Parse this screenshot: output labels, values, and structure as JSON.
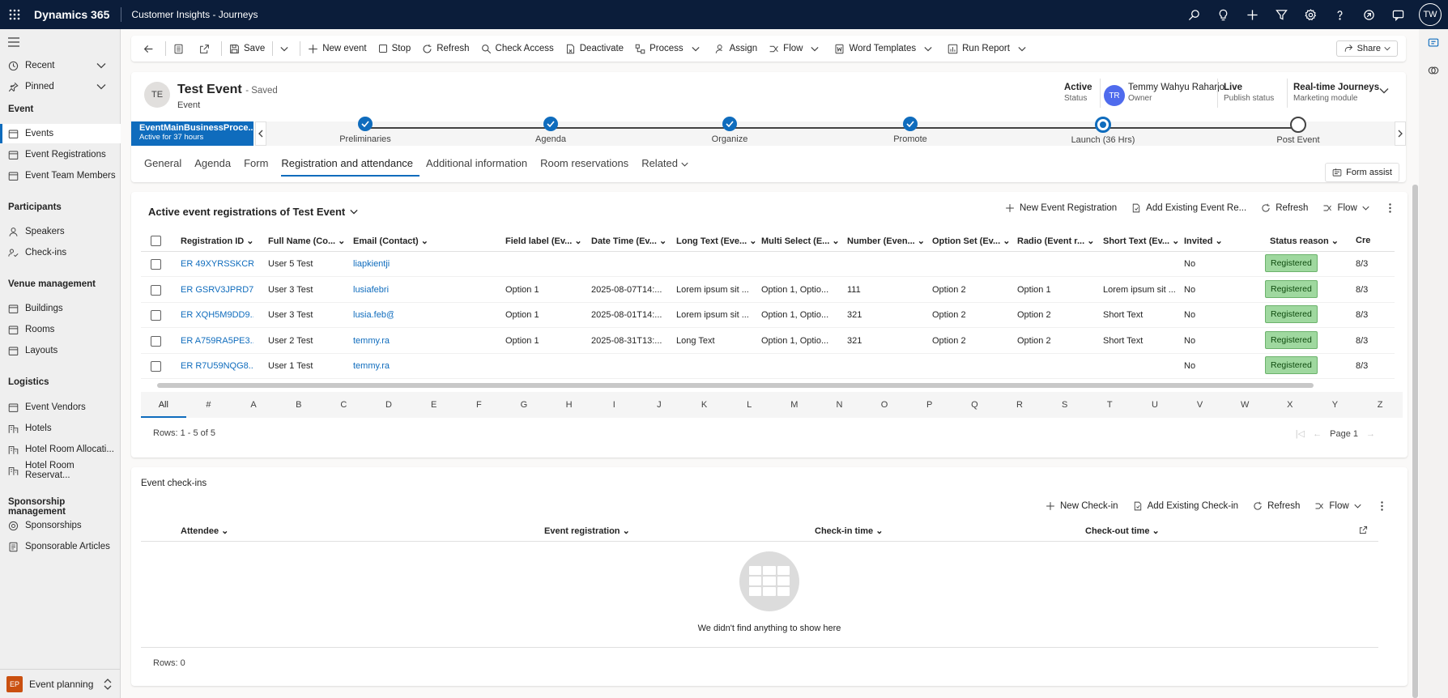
{
  "topbar": {
    "app_name": "Dynamics 365",
    "app_sub": "Customer Insights - Journeys",
    "icons": [
      "search-icon",
      "lightbulb-icon",
      "plus-icon",
      "filter-icon",
      "settings-icon",
      "help-icon",
      "copilot-icon",
      "chat-icon"
    ],
    "user_initials": "TW"
  },
  "sidebar": {
    "recent": "Recent",
    "pinned": "Pinned",
    "sections": [
      {
        "title": "Event",
        "items": [
          "Events",
          "Event Registrations",
          "Event Team Members"
        ]
      },
      {
        "title": "Participants",
        "items": [
          "Speakers",
          "Check-ins"
        ]
      },
      {
        "title": "Venue management",
        "items": [
          "Buildings",
          "Rooms",
          "Layouts"
        ]
      },
      {
        "title": "Logistics",
        "items": [
          "Event Vendors",
          "Hotels",
          "Hotel Room Allocati...",
          "Hotel Room Reservat..."
        ]
      },
      {
        "title": "Sponsorship management",
        "items": [
          "Sponsorships",
          "Sponsorable Articles"
        ]
      }
    ],
    "area": {
      "badge": "EP",
      "label": "Event planning"
    }
  },
  "commandbar": {
    "save": "Save",
    "new_event": "New event",
    "stop": "Stop",
    "refresh": "Refresh",
    "check_access": "Check Access",
    "deactivate": "Deactivate",
    "process": "Process",
    "assign": "Assign",
    "flow": "Flow",
    "word_templates": "Word Templates",
    "run_report": "Run Report",
    "share": "Share"
  },
  "record": {
    "initials": "TE",
    "title": "Test Event",
    "saved": "- Saved",
    "entity": "Event",
    "status_value": "Active",
    "status_label": "Status",
    "owner_initials": "TR",
    "owner_name": "Temmy Wahyu Raharjo",
    "owner_label": "Owner",
    "publish_value": "Live",
    "publish_label": "Publish status",
    "module_value": "Real-time Journeys",
    "module_label": "Marketing module"
  },
  "bpf": {
    "active_name": "EventMainBusinessProce...",
    "active_duration": "Active for 37 hours",
    "stages": [
      {
        "label": "Preliminaries",
        "state": "done"
      },
      {
        "label": "Agenda",
        "state": "done"
      },
      {
        "label": "Organize",
        "state": "done"
      },
      {
        "label": "Promote",
        "state": "done"
      },
      {
        "label": "Launch  (36 Hrs)",
        "state": "active"
      },
      {
        "label": "Post Event",
        "state": "pending"
      }
    ]
  },
  "tabs": [
    "General",
    "Agenda",
    "Form",
    "Registration and attendance",
    "Additional information",
    "Room reservations",
    "Related"
  ],
  "form_assist": "Form assist",
  "registrations": {
    "title": "Active event registrations of Test Event",
    "cmd_new": "New Event Registration",
    "cmd_add": "Add Existing Event Re...",
    "cmd_refresh": "Refresh",
    "cmd_flow": "Flow",
    "columns": [
      "Registration ID",
      "Full Name (Co...",
      "Email (Contact)",
      "Field label (Ev...",
      "Date Time (Ev...",
      "Long Text (Eve...",
      "Multi Select (E...",
      "Number (Even...",
      "Option Set (Ev...",
      "Radio (Event r...",
      "Short Text (Ev...",
      "Invited",
      "Status reason",
      "Cre"
    ],
    "rows": [
      [
        "ER 49XYRSSKCR...",
        "User 5 Test",
        "liapkientji",
        "",
        "",
        "",
        "",
        "",
        "",
        "",
        "",
        "No",
        "Registered",
        "8/3"
      ],
      [
        "ER GSRV3JPRD7...",
        "User 3 Test",
        "lusiafebri",
        "Option 1",
        "2025-08-07T14:...",
        "Lorem ipsum sit ...",
        "Option 1, Optio...",
        "111",
        "Option 2",
        "Option 1",
        "Lorem ipsum sit ...",
        "No",
        "Registered",
        "8/3"
      ],
      [
        "ER XQH5M9DD9...",
        "User 3 Test",
        "lusia.feb@",
        "Option 1",
        "2025-08-01T14:...",
        "Lorem ipsum sit ...",
        "Option 1, Optio...",
        "321",
        "Option 2",
        "Option 2",
        "Short Text",
        "No",
        "Registered",
        "8/3"
      ],
      [
        "ER A759RA5PE3...",
        "User 2 Test",
        "temmy.ra",
        "Option 1",
        "2025-08-31T13:...",
        "Long Text",
        "Option 1, Optio...",
        "321",
        "Option 2",
        "Option 2",
        "Short Text",
        "No",
        "Registered",
        "8/3"
      ],
      [
        "ER R7U59NQG8...",
        "User 1 Test",
        "temmy.ra",
        "",
        "",
        "",
        "",
        "",
        "",
        "",
        "",
        "No",
        "Registered",
        "8/3"
      ]
    ],
    "alphabet": [
      "All",
      "#",
      "A",
      "B",
      "C",
      "D",
      "E",
      "F",
      "G",
      "H",
      "I",
      "J",
      "K",
      "L",
      "M",
      "N",
      "O",
      "P",
      "Q",
      "R",
      "S",
      "T",
      "U",
      "V",
      "W",
      "X",
      "Y",
      "Z"
    ],
    "rows_label": "Rows: 1 - 5 of 5",
    "page_label": "Page 1"
  },
  "checkins": {
    "title": "Event check-ins",
    "cmd_new": "New Check-in",
    "cmd_add": "Add Existing Check-in",
    "cmd_refresh": "Refresh",
    "cmd_flow": "Flow",
    "columns": [
      "Attendee",
      "Event registration",
      "Check-in time",
      "Check-out time"
    ],
    "empty_text": "We didn't find anything to show here",
    "rows_label": "Rows: 0"
  }
}
